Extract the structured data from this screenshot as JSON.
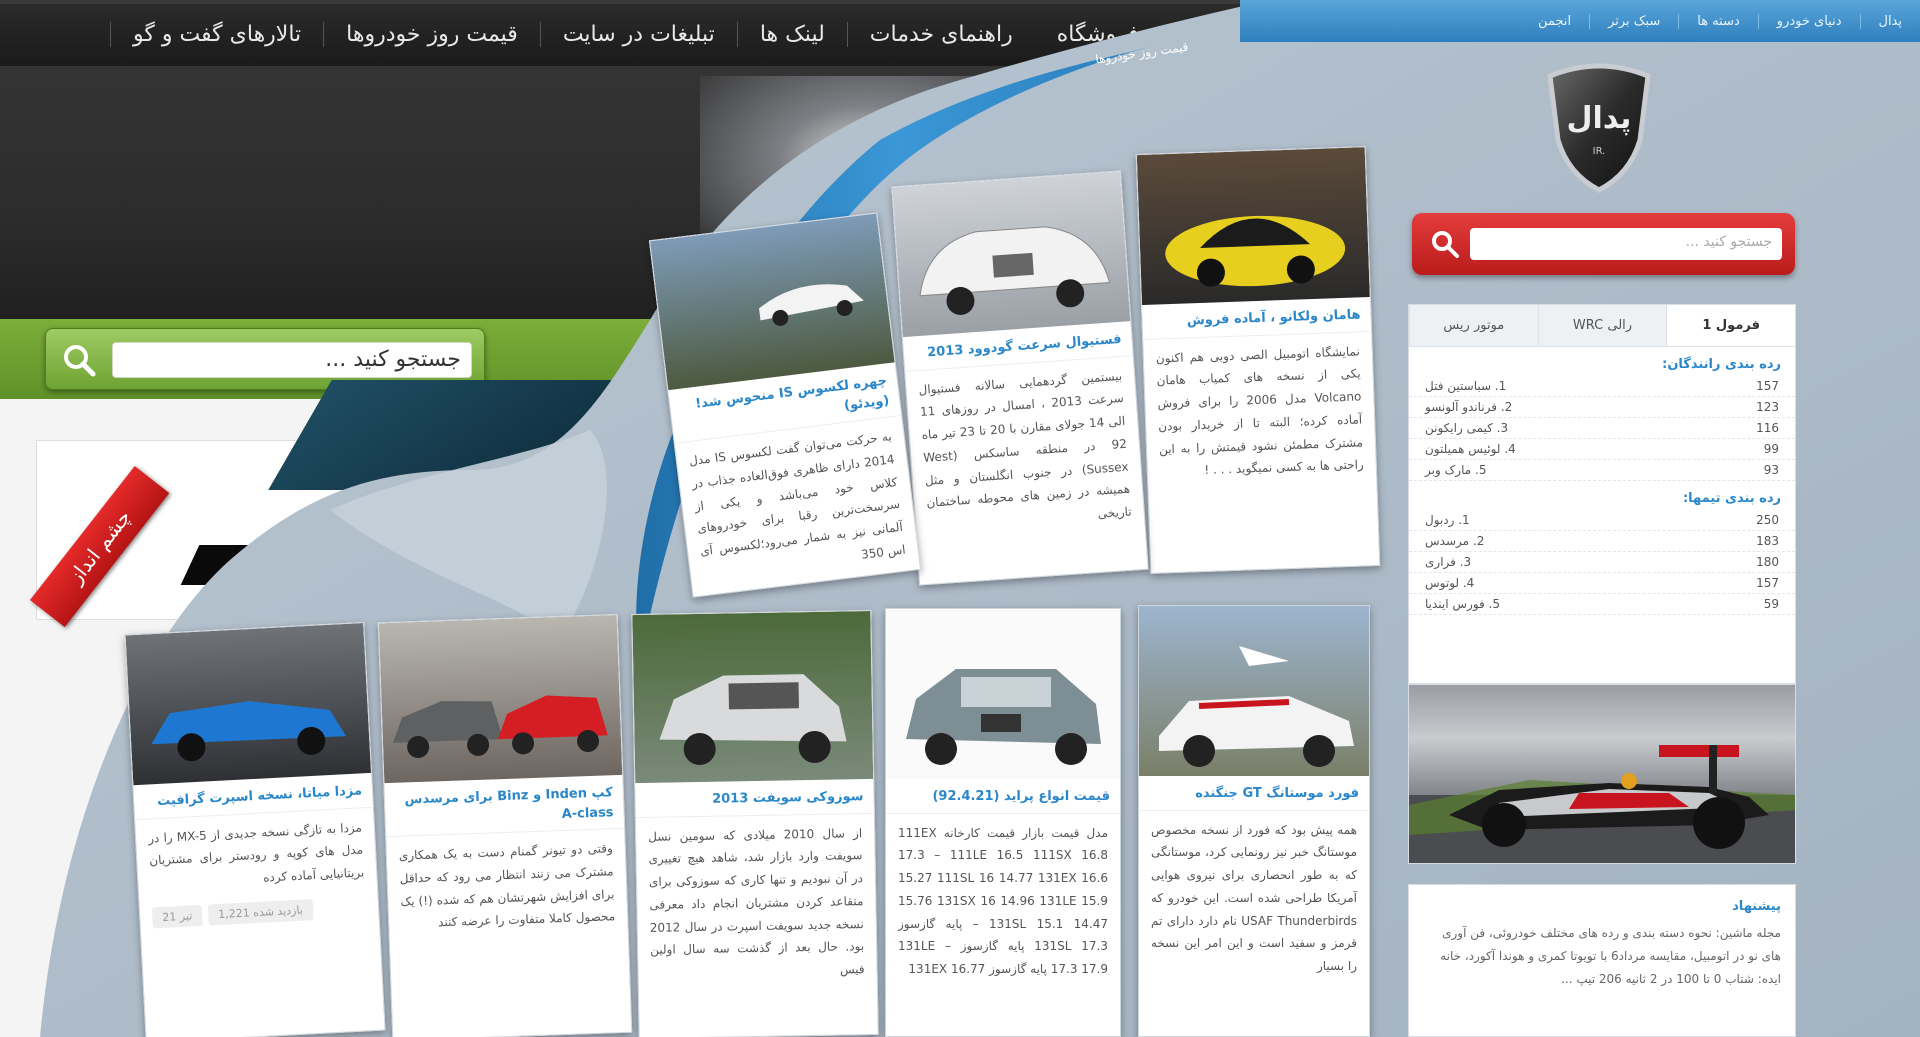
{
  "old_site": {
    "nav": [
      "تالارهای گفت و گو",
      "قیمت روز خودروها",
      "تبلیغات در سایت",
      "لینک ها",
      "راهنمای خدمات",
      "فروشگاه"
    ],
    "search_placeholder": "جستجو کنید ...",
    "ribbon": "چشم انداز"
  },
  "new_site": {
    "top_nav": [
      "پدال",
      "دنیای خودرو",
      "دسته ها",
      "سبک برتر",
      "انجمن"
    ],
    "subnav": "قیمت روز خودروها",
    "logo_text": "پدال",
    "logo_sub": "IR.",
    "search_placeholder": "جستجو کنید ...",
    "tabs": [
      "فرمول 1",
      "رالی WRC",
      "موتور ریس"
    ],
    "drivers_title": "رده بندی رانندگان:",
    "drivers": [
      {
        "name": "1. سباستین فتل",
        "pts": "157"
      },
      {
        "name": "2. فرناندو آلونسو",
        "pts": "123"
      },
      {
        "name": "3. کیمی رایکونن",
        "pts": "116"
      },
      {
        "name": "4. لوئیس همیلتون",
        "pts": "99"
      },
      {
        "name": "5. مارک وبر",
        "pts": "93"
      }
    ],
    "teams_title": "رده بندی تیمها:",
    "teams": [
      {
        "name": "1. ردبول",
        "pts": "250"
      },
      {
        "name": "2. مرسدس",
        "pts": "183"
      },
      {
        "name": "3. فراری",
        "pts": "180"
      },
      {
        "name": "4. لوتوس",
        "pts": "157"
      },
      {
        "name": "5. فورس ایندیا",
        "pts": "59"
      }
    ],
    "suggest_title": "پیشنهاد",
    "suggest_text": "مجله ماشین: نحوه دسته بندی و رده های مختلف خودروئی، فن آوری های نو در اتومبیل، مقایسه مرداد6 با تویوتا کمری و هوندا آکورد، خانه ایده: شتاب 0 تا 100 در 2 ثانیه 206 تیپ ..."
  },
  "cards": [
    {
      "title": "هامان ولکانو ، آماده فروش",
      "body": "نمایشگاه اتومبیل الصی دوبی هم اکنون یکی از نسخه های کمیاب هامان Volcano مدل 2006 را برای فروش آماده کرده؛ البته تا از خریدار بودن مشترک مطمئن نشود قیمتش را به این راحتی ها به کسی نمیگوید . . . !"
    },
    {
      "title": "فستیوال سرعت گودوود 2013",
      "body": "بیستمین گردهمایی سالانه فستیوال سرعت 2013 ، امسال در روزهای 11 الی 14 جولای مقارن با 20 تا 23 تیر ماه 92 در منطقه ساسکس (West Sussex) در جنوب انگلستان و مثل همیشه در زمین های محوطه ساختمان تاریخی"
    },
    {
      "title": "چهره لکسوس IS منحوس شد! (ویدئو)",
      "body": "به حرکت می‌توان گفت لکسوس IS مدل 2014 دارای ظاهری فوق‌العاده جذاب در کلاس خود می‌باشد و یکی از سرسخت‌ترین رقبا برای خودروهای آلمانی نیز به شمار می‌رود؛لکسوس آی اس 350"
    },
    {
      "title": "فورد موستانگ GT جنگنده",
      "body": "همه پیش بود که فورد از نسخه مخصوص موستانگ خبر نیز رونمایی کرد، موستانگی که به طور انحصاری برای نیروی هوایی آمریکا طراحی شده است. این خودرو که USAF Thunderbirds نام دارد دارای تم قرمز و سفید است و این امر این نسخه را بسیار"
    },
    {
      "title": "قیمت انواع پراید (92.4.21)",
      "body": "مدل قیمت بازار قیمت کارخانه 111EX 17.3 – 111LE 16.5 111SX 16.8 15.27 111SL 16 14.77 131EX 16.6 15.76 131SX 16 14.96 131LE 15.9 – 131SL 15.1 14.47 پایه گازسوز 131SL 17.3 پایه گازسوز 131LE – 17.3 17.9 پایه گازسوز 131EX 16.77"
    },
    {
      "title": "سوزوکی سویفت 2013",
      "body": "از سال 2010 میلادی که سومین نسل سویفت وارد بازار شد، شاهد هیچ تغییری در آن نبودیم و تنها کاری که سوزوکی برای متقاعد کردن مشتریان انجام داد معرفی نسخه جدید سویفت اسپرت در سال 2012 بود. حال بعد از گذشت سه سال اولین فیس"
    },
    {
      "title": "کپ Inden و Binz برای مرسدس A-class",
      "body": "وقتی دو تیونر گمنام دست به یک همکاری مشترک می زنند انتظار می رود که حداقل برای افزایش شهرتشان هم که شده (!) یک محصول کاملا متفاوت را عرضه کنند"
    },
    {
      "title": "مزدا میاتا، نسخه اسپرت گرافیت",
      "body": "مزدا به تازگی نسخه جدیدی از MX-5 را در مدل های کوپه و رودستر برای مشتریان بریتانیایی آماده کرده"
    }
  ],
  "card_meta": [
    "21 تیر",
    "1,221 بازدید شده"
  ],
  "colors": {
    "old_nav": "#1f1f1f",
    "old_green": "#6fa232",
    "new_blue": "#3b8fcf",
    "new_red": "#c92626",
    "link_blue": "#2a87c9",
    "peel": "#a9b7c4"
  }
}
